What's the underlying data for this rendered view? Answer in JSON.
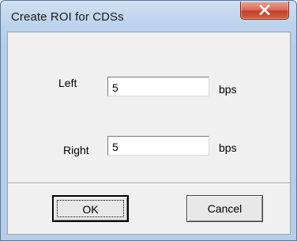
{
  "window": {
    "title": "Create ROI for CDSs"
  },
  "form": {
    "left_label": "Left",
    "left_value": "5",
    "left_unit": "bps",
    "right_label": "Right",
    "right_value": "5",
    "right_unit": "bps"
  },
  "buttons": {
    "ok_label": "OK",
    "cancel_label": "Cancel"
  },
  "colors": {
    "close_button": "#c4402a",
    "title_bar": "#bcd3ec",
    "client_area": "#f0f0f0"
  }
}
